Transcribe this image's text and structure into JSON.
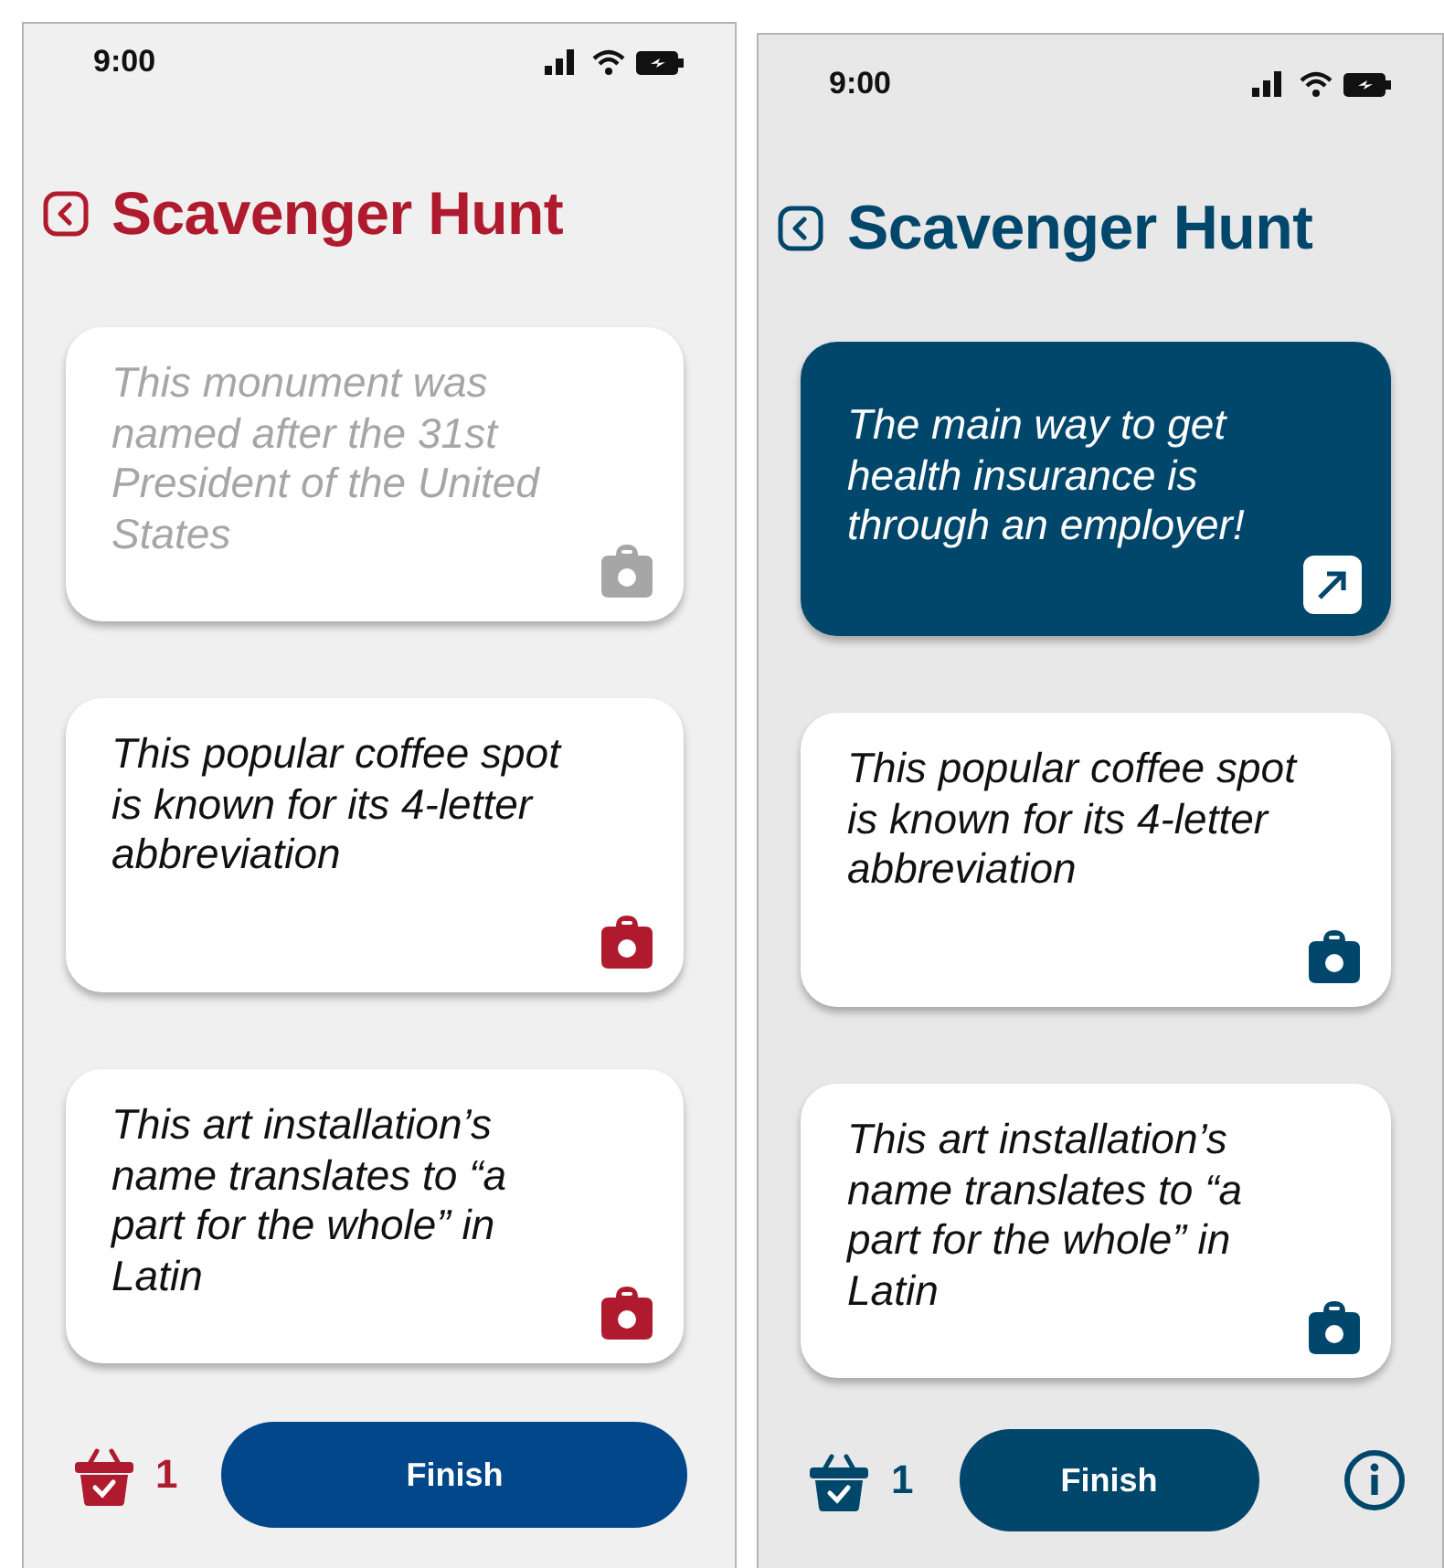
{
  "screens": [
    {
      "color": "#b01a2e",
      "status_bar": {
        "time": "9:00"
      },
      "title": "Scavenger Hunt",
      "cards": [
        {
          "kind": "found",
          "text": "This monument was named after the 31st President of the United States"
        },
        {
          "kind": "clue",
          "text": "This popular coffee spot is known for its 4-letter abbreviation"
        },
        {
          "kind": "clue",
          "text": "This art installation’s name translates to “a part for the whole” in Latin"
        }
      ],
      "basket_count": "1",
      "finish_button": {
        "label": "Finish",
        "color": "#02478a"
      },
      "info_button": false
    },
    {
      "color": "#00476b",
      "status_bar": {
        "time": "9:00"
      },
      "title": "Scavenger Hunt",
      "cards": [
        {
          "kind": "revealed",
          "text": "The main way to get health insurance is through an employer!"
        },
        {
          "kind": "clue",
          "text": "This popular coffee spot is known for its 4-letter abbreviation"
        },
        {
          "kind": "clue",
          "text": "This art installation’s name translates to “a part for the whole” in Latin"
        }
      ],
      "basket_count": "1",
      "finish_button": {
        "label": "Finish",
        "color": "#00476b"
      },
      "info_button": true
    }
  ]
}
